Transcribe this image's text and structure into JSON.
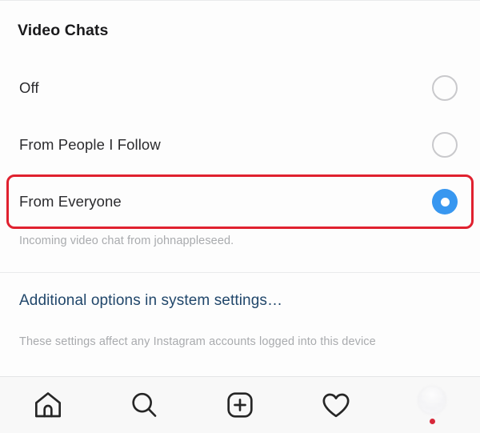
{
  "screen": {
    "title": "Video Chats"
  },
  "options": [
    {
      "label": "Off",
      "selected": false,
      "icon": "radio-unselected-icon"
    },
    {
      "label": "From People I Follow",
      "selected": false,
      "icon": "radio-unselected-icon"
    },
    {
      "label": "From Everyone",
      "selected": true,
      "icon": "radio-selected-icon"
    }
  ],
  "caption": "Incoming video chat from johnappleseed.",
  "system_link": "Additional options in system settings…",
  "footnote": "These settings affect any Instagram accounts logged into this device",
  "highlight": {
    "target_option": "From Everyone",
    "color": "#e0212f"
  },
  "bottom_nav": [
    {
      "name": "home-icon",
      "label": "Home"
    },
    {
      "name": "search-icon",
      "label": "Search"
    },
    {
      "name": "add-post-icon",
      "label": "New Post"
    },
    {
      "name": "heart-icon",
      "label": "Activity"
    },
    {
      "name": "profile-avatar",
      "label": "Profile",
      "has_badge": true
    }
  ],
  "colors": {
    "accent_blue": "#3897f0",
    "link_navy": "#21476b",
    "muted_text": "#a9abae",
    "highlight_red": "#e0212f",
    "badge_red": "#d7283a"
  }
}
